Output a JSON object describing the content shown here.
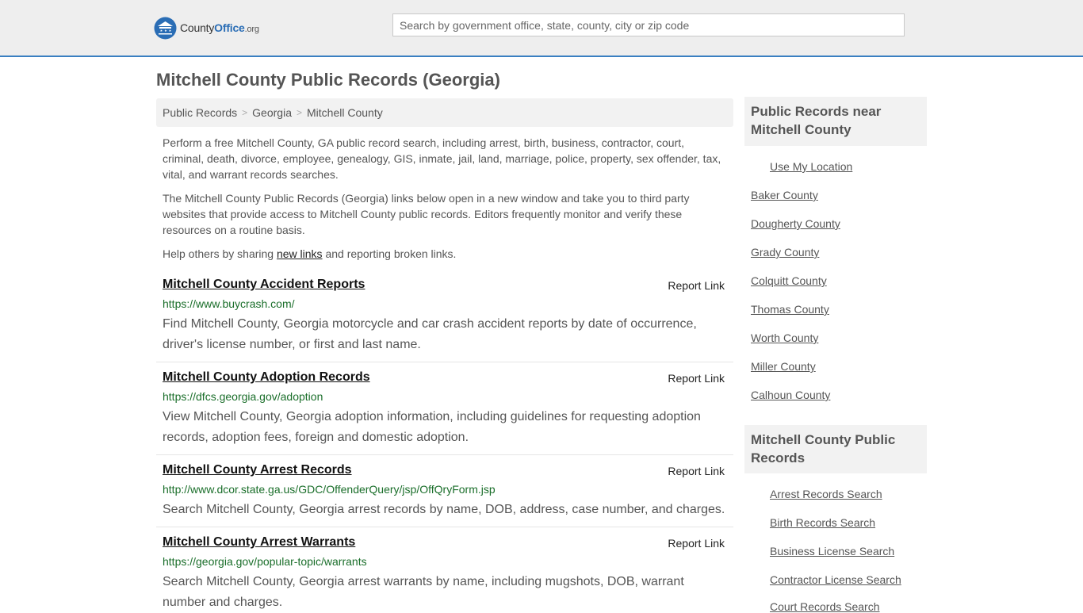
{
  "header": {
    "logo_prefix": "County",
    "logo_office": "Office",
    "logo_org": ".org",
    "search_placeholder": "Search by government office, state, county, city or zip code"
  },
  "page_title": "Mitchell County Public Records (Georgia)",
  "breadcrumb": [
    "Public Records",
    "Georgia",
    "Mitchell County"
  ],
  "breadcrumb_sep": ">",
  "intro": {
    "p1": "Perform a free Mitchell County, GA public record search, including arrest, birth, business, contractor, court, criminal, death, divorce, employee, genealogy, GIS, inmate, jail, land, marriage, police, property, sex offender, tax, vital, and warrant records searches.",
    "p2": "The Mitchell County Public Records (Georgia) links below open in a new window and take you to third party websites that provide access to Mitchell County public records. Editors frequently monitor and verify these resources on a routine basis.",
    "p3_before": "Help others by sharing ",
    "p3_link": "new links",
    "p3_after": " and reporting broken links."
  },
  "report_label": "Report Link",
  "records": [
    {
      "title": "Mitchell County Accident Reports",
      "url": "https://www.buycrash.com/",
      "desc": "Find Mitchell County, Georgia motorcycle and car crash accident reports by date of occurrence, driver's license number, or first and last name."
    },
    {
      "title": "Mitchell County Adoption Records",
      "url": "https://dfcs.georgia.gov/adoption",
      "desc": "View Mitchell County, Georgia adoption information, including guidelines for requesting adoption records, adoption fees, foreign and domestic adoption."
    },
    {
      "title": "Mitchell County Arrest Records",
      "url": "http://www.dcor.state.ga.us/GDC/OffenderQuery/jsp/OffQryForm.jsp",
      "desc": "Search Mitchell County, Georgia arrest records by name, DOB, address, case number, and charges."
    },
    {
      "title": "Mitchell County Arrest Warrants",
      "url": "https://georgia.gov/popular-topic/warrants",
      "desc": "Search Mitchell County, Georgia arrest warrants by name, including mugshots, DOB, warrant number and charges."
    }
  ],
  "sidebar": {
    "near_title": "Public Records near Mitchell County",
    "use_location": "Use My Location",
    "near_counties": [
      "Baker County",
      "Dougherty County",
      "Grady County",
      "Colquitt County",
      "Thomas County",
      "Worth County",
      "Miller County",
      "Calhoun County"
    ],
    "records_title": "Mitchell County Public Records",
    "record_links": [
      "Arrest Records Search",
      "Birth Records Search",
      "Business License Search",
      "Contractor License Search",
      "Court Records Search"
    ]
  },
  "colors": {
    "header_bg": "#eeeeee",
    "header_border": "#3a7fc1",
    "url_green": "#1a6e2a",
    "logo_blue": "#2a6db5"
  }
}
